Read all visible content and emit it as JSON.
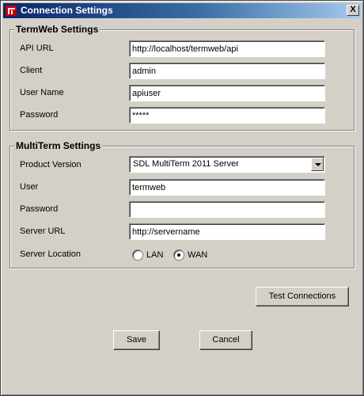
{
  "window": {
    "title": "Connection Settings",
    "close_label": "X"
  },
  "termweb": {
    "legend": "TermWeb Settings",
    "fields": [
      {
        "label": "API URL",
        "value": "http://localhost/termweb/api"
      },
      {
        "label": "Client",
        "value": "admin"
      },
      {
        "label": "User Name",
        "value": "apiuser"
      },
      {
        "label": "Password",
        "value": "*****"
      }
    ]
  },
  "multiterm": {
    "legend": "MultiTerm Settings",
    "product_version_label": "Product Version",
    "product_version_value": "SDL MultiTerm 2011 Server",
    "user_label": "User",
    "user_value": "termweb",
    "password_label": "Password",
    "password_value": "",
    "server_url_label": "Server URL",
    "server_url_value": "http://servername",
    "server_location_label": "Server Location",
    "location_options": [
      {
        "label": "LAN",
        "selected": false
      },
      {
        "label": "WAN",
        "selected": true
      }
    ]
  },
  "buttons": {
    "test_connections": "Test Connections",
    "save": "Save",
    "cancel": "Cancel"
  },
  "colors": {
    "title_bar_start": "#0a246a",
    "title_bar_end": "#a6caf0",
    "window_face": "#d4d0c8"
  }
}
